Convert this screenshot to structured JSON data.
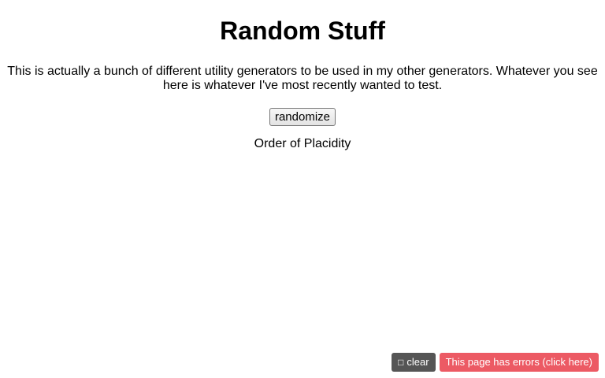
{
  "page": {
    "title": "Random Stuff",
    "description": "This is actually a bunch of different utility generators to be used in my other generators. Whatever you see here is whatever I've most recently wanted to test.",
    "randomize_label": "randomize",
    "result_text": "Order of Placidity"
  },
  "footer": {
    "clear_icon": "trash-icon",
    "clear_label": "clear",
    "errors_label": "This page has errors (click here)"
  },
  "colors": {
    "clear_bg": "#555555",
    "errors_bg": "#ec5a64"
  }
}
